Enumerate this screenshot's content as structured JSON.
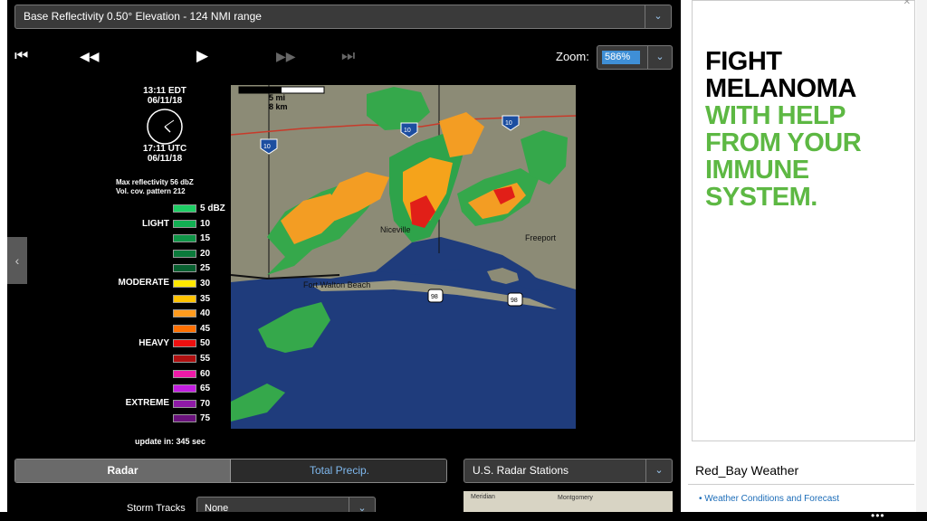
{
  "product_select": {
    "label": "Base Reflectivity 0.50° Elevation - 124 NMI range"
  },
  "zoom": {
    "label": "Zoom:",
    "value": "586%"
  },
  "playback": {
    "first": "⏮",
    "back": "◀◀",
    "play": "▶",
    "forward": "▶▶",
    "last": "⏭"
  },
  "time": {
    "local_time": "13:11  EDT",
    "local_date": "06/11/18",
    "utc_time": "17:11  UTC",
    "utc_date": "06/11/18"
  },
  "radar_info": {
    "max": "Max reflectivity  56  dbZ",
    "vcp": "Vol. cov. pattern  212"
  },
  "legend": {
    "categories": [
      "LIGHT",
      "MODERATE",
      "HEAVY",
      "EXTREME"
    ],
    "levels": [
      {
        "label": "5  dBZ",
        "color": "#1fce65"
      },
      {
        "label": "10",
        "color": "#12b053"
      },
      {
        "label": "15",
        "color": "#0f9547"
      },
      {
        "label": "20",
        "color": "#0b7a3b"
      },
      {
        "label": "25",
        "color": "#086030"
      },
      {
        "label": "30",
        "color": "#ffe800"
      },
      {
        "label": "35",
        "color": "#ffc300"
      },
      {
        "label": "40",
        "color": "#ff9b1e"
      },
      {
        "label": "45",
        "color": "#ff7000"
      },
      {
        "label": "50",
        "color": "#ee1010"
      },
      {
        "label": "55",
        "color": "#b01010"
      },
      {
        "label": "60",
        "color": "#ee1aa8"
      },
      {
        "label": "65",
        "color": "#c21ee0"
      },
      {
        "label": "70",
        "color": "#8e1aa6"
      },
      {
        "label": "75",
        "color": "#6a127c"
      }
    ]
  },
  "update": {
    "text": "update in: 345 sec"
  },
  "map": {
    "scale_mi": "5  mi",
    "scale_km": "8  km",
    "places": [
      "Niceville",
      "Freeport",
      "Fort Walton Beach"
    ],
    "route_shields": [
      "10",
      "10",
      "10",
      "98",
      "98"
    ]
  },
  "tabs": {
    "radar": "Radar",
    "precip": "Total Precip."
  },
  "stations_select": {
    "label": "U.S. Radar Stations"
  },
  "storm_tracks": {
    "label": "Storm Tracks",
    "value": "None"
  },
  "thumbnail": {
    "places": [
      "Meridian",
      "Montgomery"
    ]
  },
  "ad": {
    "line1": "FIGHT",
    "line2": "MELANOMA",
    "line3": "WITH HELP",
    "line4": "FROM YOUR",
    "line5": "IMMUNE",
    "line6": "SYSTEM."
  },
  "weather_widget": {
    "title": "Red_Bay Weather",
    "link": "Weather Conditions and Forecast"
  },
  "icons": {
    "dropdown": "chevron-down-icon",
    "left": "chevron-left-icon",
    "ad_close": "close-icon",
    "more": "more-icon"
  }
}
